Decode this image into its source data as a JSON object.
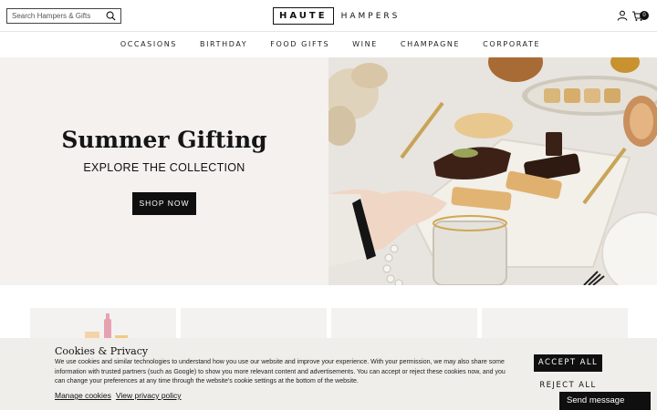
{
  "header": {
    "search": {
      "placeholder": "Search Hampers & Gifts"
    },
    "logo": {
      "boxed": "HAUTE",
      "rest": "HAMPERS"
    },
    "cart": {
      "count": "0"
    }
  },
  "nav": {
    "items": [
      {
        "label": "OCCASIONS"
      },
      {
        "label": "BIRTHDAY"
      },
      {
        "label": "FOOD GIFTS"
      },
      {
        "label": "WINE"
      },
      {
        "label": "CHAMPAGNE"
      },
      {
        "label": "CORPORATE"
      }
    ]
  },
  "hero": {
    "title": "Summer Gifting",
    "subtitle": "EXPLORE THE COLLECTION",
    "button": "SHOP NOW"
  },
  "cookie": {
    "title": "Cookies & Privacy",
    "text": "We use cookies and similar technologies to understand how you use our website and improve your experience. With your permission, we may also share some information with trusted partners (such as Google) to show you more relevant content and advertisements. You can accept or reject these cookies now, and you can change your preferences at any time through the website's cookie settings at the bottom of the website.",
    "manage_link": "Manage cookies",
    "privacy_link": "View privacy policy",
    "accept": "ACCEPT ALL",
    "reject": "REJECT ALL"
  },
  "chat": {
    "label": "Send message"
  },
  "colors": {
    "hero_bg": "#f4f1ef",
    "banner_bg": "#efeeea",
    "primary": "#0f0f0f"
  }
}
